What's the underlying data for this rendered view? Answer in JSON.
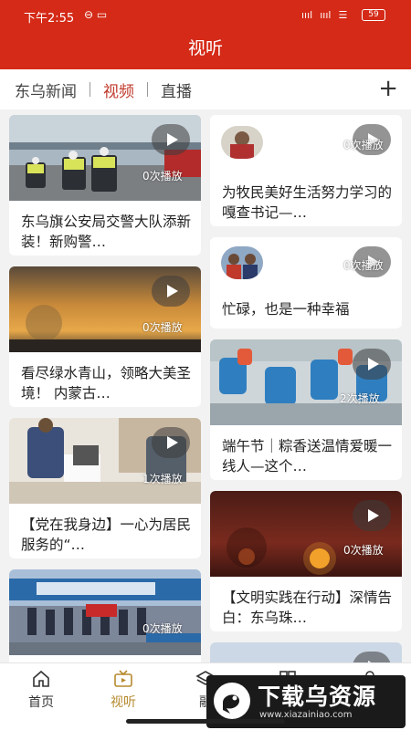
{
  "status": {
    "time": "下午2:55",
    "battery": "59"
  },
  "header": {
    "title": "视听"
  },
  "tabs": [
    {
      "label": "东乌新闻",
      "active": false
    },
    {
      "label": "视频",
      "active": true
    },
    {
      "label": "直播",
      "active": false
    }
  ],
  "feed": {
    "left": [
      {
        "title": "东乌旗公安局交警大队添新装！新购警…",
        "count": "0次播放"
      },
      {
        "title": "看尽绿水青山，领略大美圣境！ 内蒙古…",
        "count": "0次播放"
      },
      {
        "title": "【党在我身边】一心为居民服务的“…",
        "count": "1次播放"
      },
      {
        "title": "",
        "count": "0次播放"
      }
    ],
    "right": [
      {
        "title": "为牧民美好生活努力学习的嘎查书记—…",
        "count": "0次播放"
      },
      {
        "title": "忙碌，也是一种幸福",
        "count": "0次播放"
      },
      {
        "title": "端午节｜粽香送温情爱暖一线人—这个…",
        "count": "2次播放"
      },
      {
        "title": "【文明实践在行动】深情告白：东乌珠…",
        "count": "0次播放"
      }
    ]
  },
  "bottom_nav": [
    {
      "label": "首页",
      "icon": "home-icon",
      "active": false
    },
    {
      "label": "视听",
      "icon": "tv-icon",
      "active": true
    },
    {
      "label": "融",
      "icon": "layers-icon",
      "active": false
    },
    {
      "label": "",
      "icon": "grid-icon",
      "active": false
    },
    {
      "label": "",
      "icon": "user-icon",
      "active": false
    }
  ],
  "watermark": {
    "text": "下载乌资源",
    "url": "www.xiazainiao.com"
  },
  "colors": {
    "brand_red": "#d42a17",
    "active_tab": "#c0392b",
    "active_nav": "#b5892e"
  }
}
